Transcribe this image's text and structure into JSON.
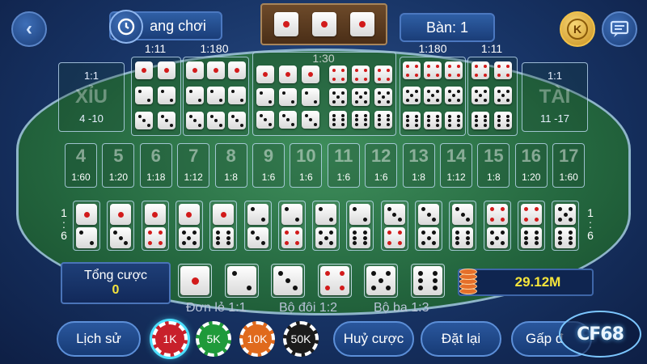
{
  "header": {
    "history_label": "ang chơi",
    "table_label": "Bàn: 1",
    "result_dice": [
      1,
      1,
      1
    ],
    "coin_letter": "K"
  },
  "combos": {
    "pair_odds_left": "1:11",
    "triple_odds_left": "1:180",
    "any_triple_odds": "1:30",
    "triple_odds_right": "1:180",
    "pair_odds_right": "1:11",
    "pairs_left": [
      1,
      2,
      3
    ],
    "triples_left": [
      1,
      2,
      3
    ],
    "any_triple_faces": [
      1,
      2,
      3,
      4,
      5,
      6
    ],
    "triples_right": [
      4,
      5,
      6
    ],
    "pairs_right": [
      4,
      5,
      6
    ]
  },
  "small": {
    "odds": "1:1",
    "name": "XỈU",
    "range": "4 -10"
  },
  "big": {
    "odds": "1:1",
    "name": "TÀI",
    "range": "11 -17"
  },
  "totals": [
    {
      "n": "4",
      "odds": "1:60"
    },
    {
      "n": "5",
      "odds": "1:20"
    },
    {
      "n": "6",
      "odds": "1:18"
    },
    {
      "n": "7",
      "odds": "1:12"
    },
    {
      "n": "8",
      "odds": "1:8"
    },
    {
      "n": "9",
      "odds": "1:6"
    },
    {
      "n": "10",
      "odds": "1:6"
    },
    {
      "n": "11",
      "odds": "1:6"
    },
    {
      "n": "12",
      "odds": "1:6"
    },
    {
      "n": "13",
      "odds": "1:8"
    },
    {
      "n": "14",
      "odds": "1:12"
    },
    {
      "n": "15",
      "odds": "1:8"
    },
    {
      "n": "16",
      "odds": "1:20"
    },
    {
      "n": "17",
      "odds": "1:60"
    }
  ],
  "dominoes": [
    [
      1,
      2
    ],
    [
      1,
      3
    ],
    [
      1,
      4
    ],
    [
      1,
      5
    ],
    [
      1,
      6
    ],
    [
      2,
      3
    ],
    [
      2,
      4
    ],
    [
      2,
      5
    ],
    [
      2,
      6
    ],
    [
      3,
      4
    ],
    [
      3,
      5
    ],
    [
      3,
      6
    ],
    [
      4,
      5
    ],
    [
      4,
      6
    ],
    [
      5,
      6
    ]
  ],
  "side_odds_left": [
    "1",
    ":",
    "6"
  ],
  "side_odds_right": [
    "1",
    ":",
    "6"
  ],
  "bet_info": {
    "total_label": "Tổng cược",
    "total_value": "0",
    "single_faces": [
      1,
      2,
      3,
      4,
      5,
      6
    ],
    "balance": "29.12M"
  },
  "payouts": {
    "single": "Đơn lẻ 1:1",
    "double": "Bộ đôi 1:2",
    "triple": "Bộ ba 1:3"
  },
  "bottom_bar": {
    "history": "Lịch sử",
    "cancel": "Huỷ cược",
    "reset": "Đặt lại",
    "double": "Gấp đ"
  },
  "chips": [
    {
      "label": "1K",
      "color": "#c8202b"
    },
    {
      "label": "5K",
      "color": "#1f9a3a"
    },
    {
      "label": "10K",
      "color": "#e06a1d"
    },
    {
      "label": "50K",
      "color": "#1b1b1b"
    }
  ],
  "logo_text": "CF68"
}
